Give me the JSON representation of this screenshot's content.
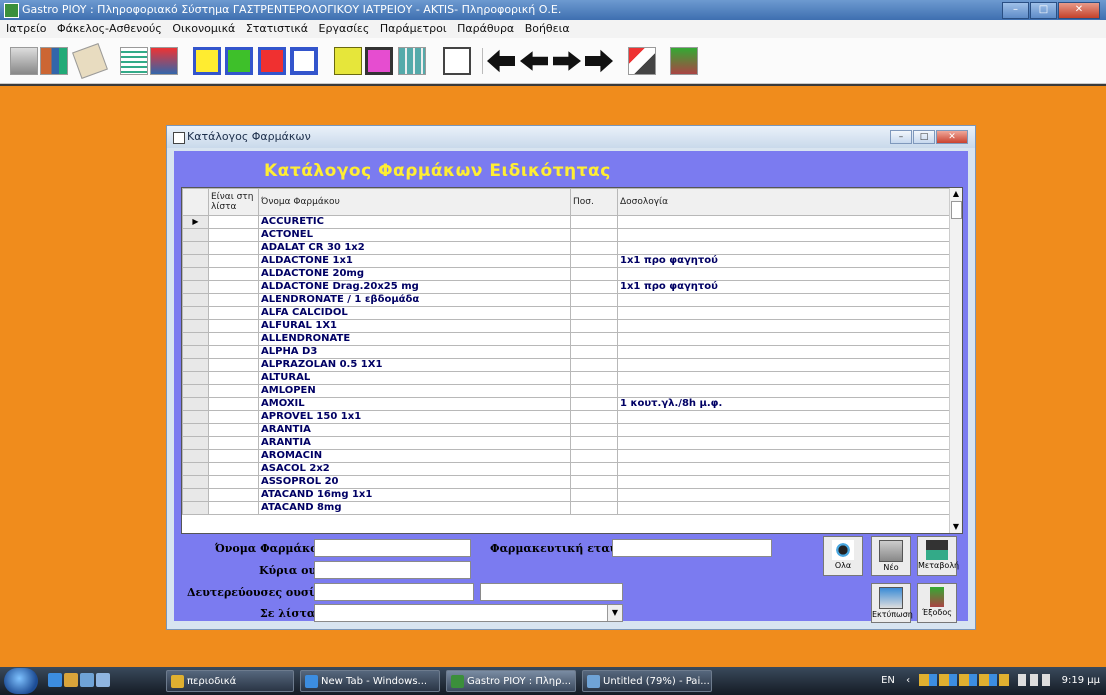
{
  "window": {
    "title": "Gastro PIOY : Πληροφοριακό Σύστημα ΓΑΣΤΡΕΝΤΕΡΟΛΟΓΙΚΟΥ ΙΑΤΡΕΙΟΥ  -    AKTIS- Πληροφορική Ο.Ε."
  },
  "menu": [
    "Ιατρείο",
    "Φάκελος-Ασθενούς",
    "Οικονομικά",
    "Στατιστικά",
    "Εργασίες",
    "Παράμετροι",
    "Παράθυρα",
    "Βοήθεια"
  ],
  "toolbar_icons": [
    "calculator-icon",
    "patients-icon",
    "notebook-icon",
    "chart-sheet-icon",
    "clinic-icon",
    "stomach-yellow-icon",
    "stomach-green-icon",
    "stomach-red-icon",
    "colon-icon",
    "pylorus-icon",
    "monitor-icon",
    "calculator-grid-icon",
    "book-icon",
    "arrow-first-icon",
    "arrow-prev-icon",
    "arrow-next-icon",
    "arrow-last-icon",
    "tools-icon",
    "exit-door-icon"
  ],
  "dialog": {
    "title": "Κατάλογος Φαρμάκων",
    "heading": "Κατάλογος  Φαρμάκων  Ειδικότητας"
  },
  "grid": {
    "columns": [
      "Είναι στη λίστα",
      "Όνομα Φαρμάκου",
      "Ποσ.",
      "Δοσολογία"
    ],
    "rows": [
      {
        "name": "ACCURETIC",
        "dose": "",
        "current": true
      },
      {
        "name": "ACTONEL",
        "dose": ""
      },
      {
        "name": "ADALAT CR 30 1x2",
        "dose": ""
      },
      {
        "name": "ALDACTONE 1x1",
        "dose": "1x1 προ φαγητού"
      },
      {
        "name": "ALDACTONE 20mg",
        "dose": ""
      },
      {
        "name": "ALDACTONE Drag.20x25 mg",
        "dose": "1x1 προ φαγητού"
      },
      {
        "name": "ALENDRONATE / 1 εβδομάδα",
        "dose": ""
      },
      {
        "name": "ALFA CALCIDOL",
        "dose": ""
      },
      {
        "name": "ALFURAL 1X1",
        "dose": ""
      },
      {
        "name": "ALLENDRONATE",
        "dose": ""
      },
      {
        "name": "ALPHA D3",
        "dose": ""
      },
      {
        "name": "ALPRAZOLAN 0.5 1X1",
        "dose": ""
      },
      {
        "name": "ALTURAL",
        "dose": ""
      },
      {
        "name": "AMLOPEN",
        "dose": ""
      },
      {
        "name": "AMOXIL",
        "dose": "1 κουτ.γλ./8h μ.φ."
      },
      {
        "name": "APROVEL 150 1x1",
        "dose": ""
      },
      {
        "name": "ARANTIA",
        "dose": ""
      },
      {
        "name": "ARANTIA",
        "dose": ""
      },
      {
        "name": "AROMACIN",
        "dose": ""
      },
      {
        "name": "ASACOL 2x2",
        "dose": ""
      },
      {
        "name": "ASSOPROL 20",
        "dose": ""
      },
      {
        "name": "ATACAND 16mg 1x1",
        "dose": ""
      },
      {
        "name": "ATACAND 8mg",
        "dose": ""
      }
    ]
  },
  "form": {
    "drug_name_label": "Όνομα Φαρμάκου :",
    "company_label": "Φαρμακευτική εταιρία:",
    "main_substance_label": "Κύρια ουσία:",
    "secondary_substances_label": "Δευτερεύουσες ουσίες:",
    "in_list_label": "Σε λίστα:"
  },
  "buttons": {
    "all": "Ολα",
    "new": "Νέο",
    "edit": "Μεταβολή",
    "print": "Εκτύπωση",
    "exit": "Έξοδος"
  },
  "taskbar": {
    "items": [
      "περιοδικά",
      "New Tab - Windows...",
      "Gastro PIOY : Πληρ...",
      "Untitled (79%) - Pai..."
    ],
    "language": "EN",
    "clock": "9:19 μμ"
  }
}
